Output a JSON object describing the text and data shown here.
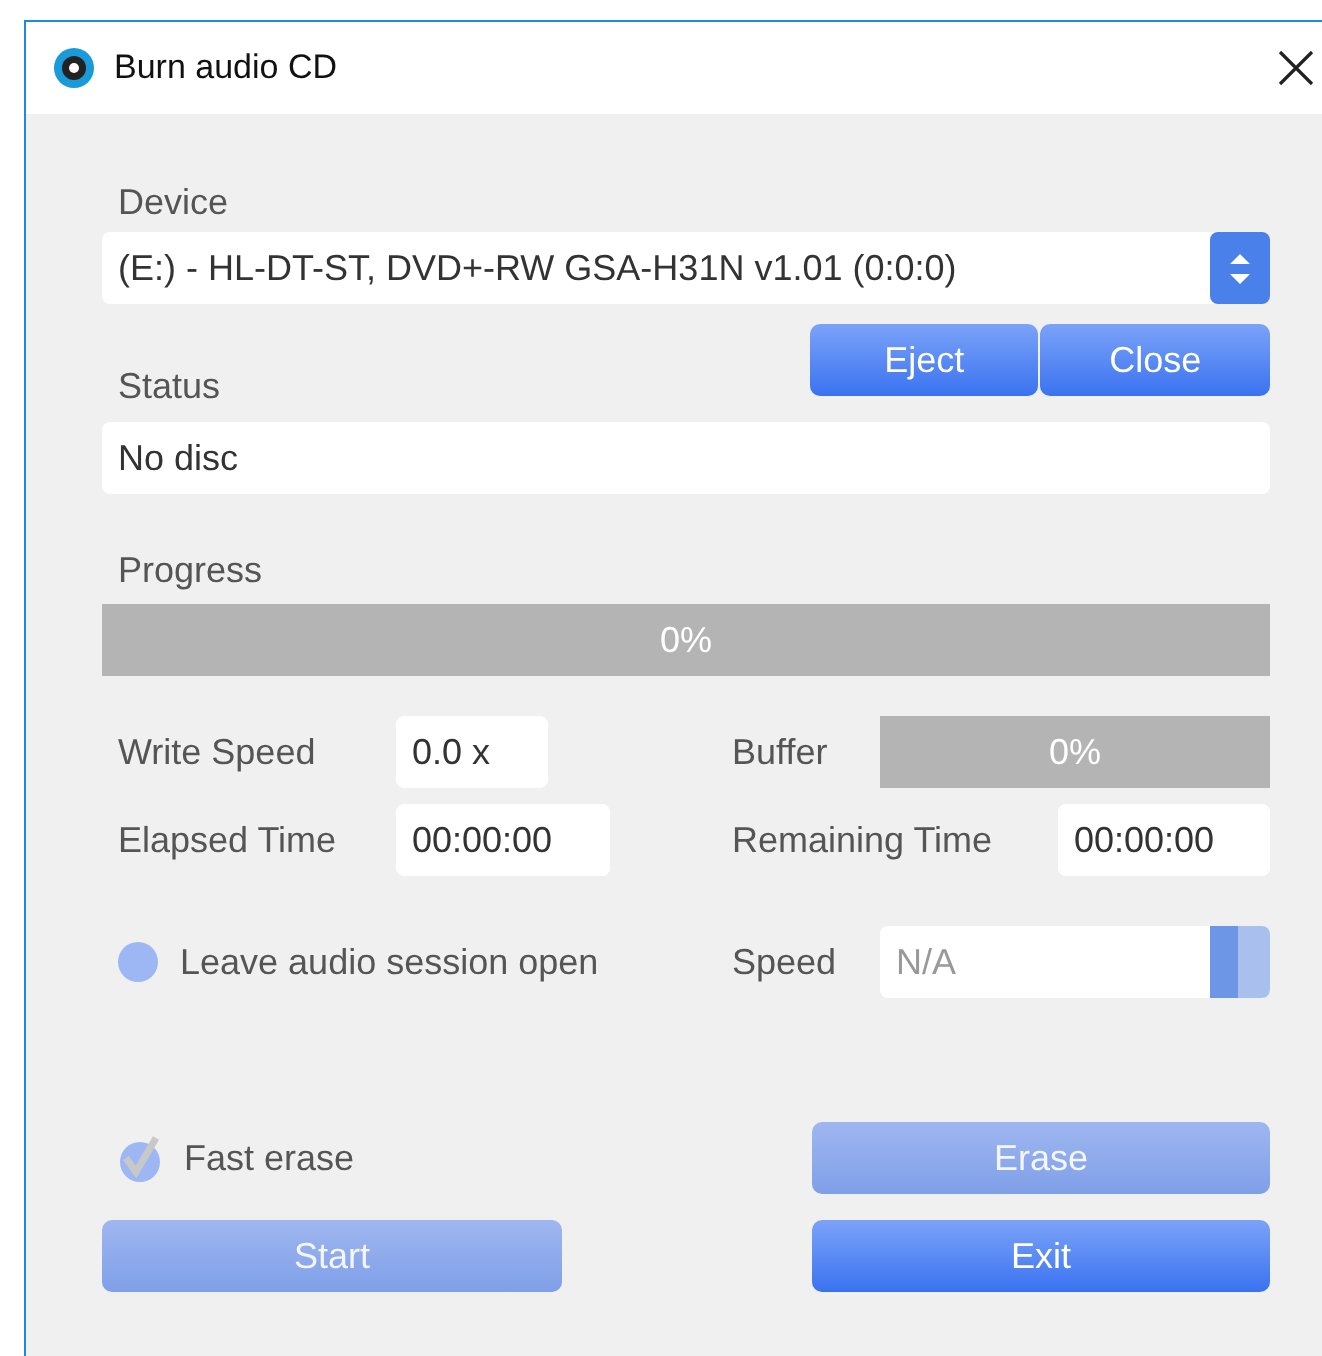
{
  "window": {
    "title": "Burn audio CD"
  },
  "device": {
    "label": "Device",
    "value": "(E:) - HL-DT-ST, DVD+-RW GSA-H31N v1.01 (0:0:0)"
  },
  "device_buttons": [
    {
      "label": "Eject",
      "disabled": false
    },
    {
      "label": "Close",
      "disabled": false
    }
  ],
  "status": {
    "label": "Status",
    "value": "No disc"
  },
  "progress": {
    "label": "Progress",
    "level": 0,
    "reading": "0%"
  },
  "write_speed": {
    "label": "Write Speed",
    "value": "0.0 x"
  },
  "buffer": {
    "label": "Buffer",
    "level": 0,
    "reading": "0%"
  },
  "elapsed_time": {
    "label": "Elapsed Time",
    "value": "00:00:00"
  },
  "remaining_time": {
    "label": "Remaining Time",
    "value": "00:00:00"
  },
  "leave_session": {
    "label": "Leave audio session open",
    "checked": false
  },
  "speed": {
    "label": "Speed",
    "placeholder": "N/A"
  },
  "fast_erase": {
    "label": "Fast erase",
    "checked": true
  },
  "erase_button": {
    "label": "Erase",
    "disabled": true
  },
  "start_button": {
    "label": "Start",
    "disabled": true
  },
  "exit_button": {
    "label": "Exit",
    "disabled": false
  }
}
